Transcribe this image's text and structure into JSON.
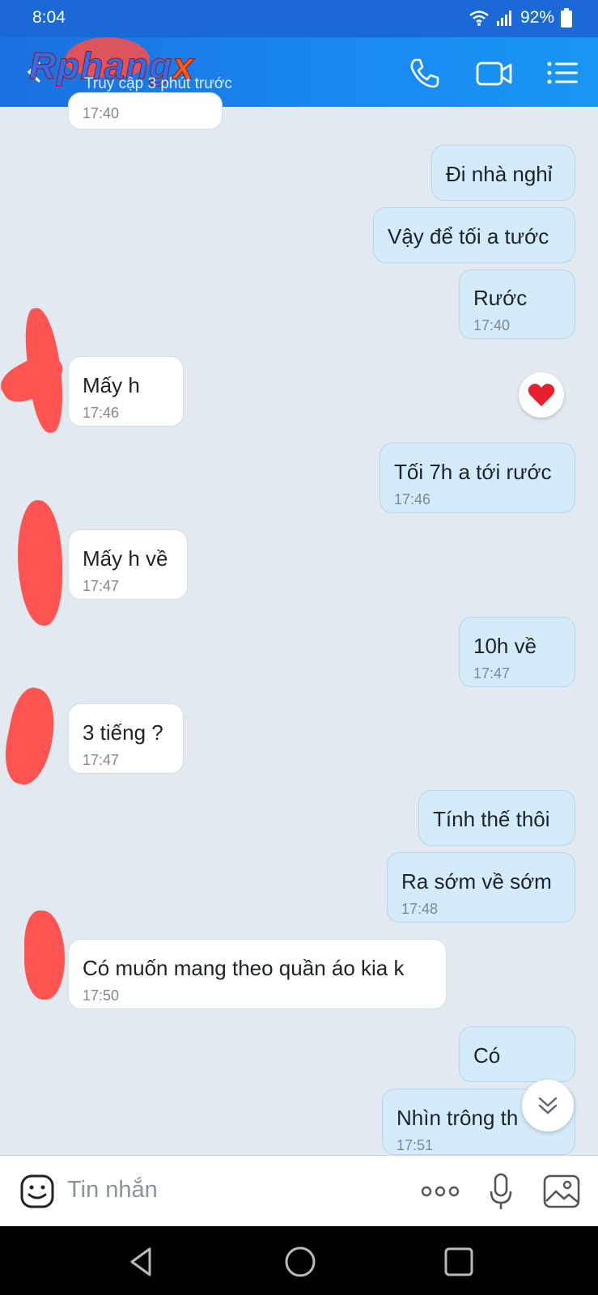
{
  "status_bar": {
    "time": "8:04",
    "battery": "92%"
  },
  "header": {
    "contact_name_main": "Rphang",
    "contact_name_x": "x",
    "last_seen": "Truy cập 3 phút trước"
  },
  "messages": [
    {
      "dir": "in",
      "text": "",
      "time": "17:40"
    },
    {
      "dir": "out",
      "text": "Đi nhà nghỉ",
      "time": ""
    },
    {
      "dir": "out",
      "text": "Vậy để tối a tước",
      "time": ""
    },
    {
      "dir": "out",
      "text": "Rước",
      "time": "17:40"
    },
    {
      "dir": "in",
      "text": "Mấy h",
      "time": "17:46"
    },
    {
      "dir": "out",
      "text": "Tối 7h a tới rước",
      "time": "17:46"
    },
    {
      "dir": "in",
      "text": "Mấy h về",
      "time": "17:47"
    },
    {
      "dir": "out",
      "text": "10h về",
      "time": "17:47"
    },
    {
      "dir": "in",
      "text": "3 tiếng ?",
      "time": "17:47"
    },
    {
      "dir": "out",
      "text": "Tính thế thôi",
      "time": ""
    },
    {
      "dir": "out",
      "text": "Ra sớm về sớm",
      "time": "17:48"
    },
    {
      "dir": "in",
      "text": "Có muốn mang theo quần áo kia k",
      "time": "17:50"
    },
    {
      "dir": "out",
      "text": "Có",
      "time": ""
    },
    {
      "dir": "out",
      "text": "Nhìn trông th",
      "time": "17:51"
    }
  ],
  "composer": {
    "placeholder": "Tin nhắn"
  },
  "colors": {
    "header": "#1a6fdf",
    "bubble_out": "#d4ebfc",
    "bubble_in": "#ffffff",
    "background": "#e2e9f1"
  }
}
